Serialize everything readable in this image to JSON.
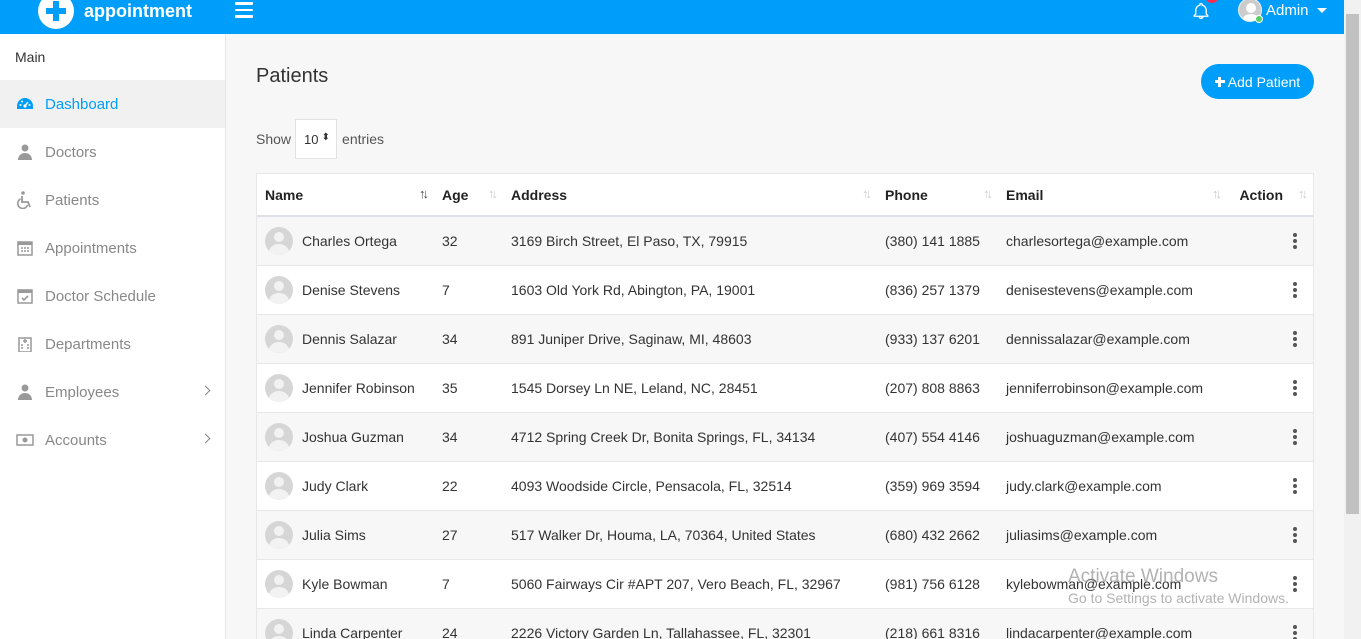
{
  "header": {
    "app_name": "appointment",
    "user_name": "Admin"
  },
  "sidebar": {
    "title": "Main",
    "items": [
      {
        "label": "Dashboard",
        "icon": "dashboard-icon",
        "active": true
      },
      {
        "label": "Doctors",
        "icon": "user-md-icon"
      },
      {
        "label": "Patients",
        "icon": "wheelchair-icon"
      },
      {
        "label": "Appointments",
        "icon": "calendar-icon"
      },
      {
        "label": "Doctor Schedule",
        "icon": "calendar-check-icon"
      },
      {
        "label": "Departments",
        "icon": "hospital-icon"
      },
      {
        "label": "Employees",
        "icon": "user-icon",
        "has_submenu": true
      },
      {
        "label": "Accounts",
        "icon": "money-icon",
        "has_submenu": true
      }
    ]
  },
  "page": {
    "title": "Patients",
    "add_button": "Add Patient",
    "show_label": "Show",
    "entries_value": "10",
    "entries_label": "entries"
  },
  "table": {
    "columns": [
      "Name",
      "Age",
      "Address",
      "Phone",
      "Email",
      "Action"
    ],
    "rows": [
      {
        "name": "Charles Ortega",
        "age": "32",
        "address": "3169 Birch Street, El Paso, TX, 79915",
        "phone": "(380) 141 1885",
        "email": "charlesortega@example.com"
      },
      {
        "name": "Denise Stevens",
        "age": "7",
        "address": "1603 Old York Rd, Abington, PA, 19001",
        "phone": "(836) 257 1379",
        "email": "denisestevens@example.com"
      },
      {
        "name": "Dennis Salazar",
        "age": "34",
        "address": "891 Juniper Drive, Saginaw, MI, 48603",
        "phone": "(933) 137 6201",
        "email": "dennissalazar@example.com"
      },
      {
        "name": "Jennifer Robinson",
        "age": "35",
        "address": "1545 Dorsey Ln NE, Leland, NC, 28451",
        "phone": "(207) 808 8863",
        "email": "jenniferrobinson@example.com"
      },
      {
        "name": "Joshua Guzman",
        "age": "34",
        "address": "4712 Spring Creek Dr, Bonita Springs, FL, 34134",
        "phone": "(407) 554 4146",
        "email": "joshuaguzman@example.com"
      },
      {
        "name": "Judy Clark",
        "age": "22",
        "address": "4093 Woodside Circle, Pensacola, FL, 32514",
        "phone": "(359) 969 3594",
        "email": "judy.clark@example.com"
      },
      {
        "name": "Julia Sims",
        "age": "27",
        "address": "517 Walker Dr, Houma, LA, 70364, United States",
        "phone": "(680) 432 2662",
        "email": "juliasims@example.com"
      },
      {
        "name": "Kyle Bowman",
        "age": "7",
        "address": "5060 Fairways Cir #APT 207, Vero Beach, FL, 32967",
        "phone": "(981) 756 6128",
        "email": "kylebowman@example.com"
      },
      {
        "name": "Linda Carpenter",
        "age": "24",
        "address": "2226 Victory Garden Ln, Tallahassee, FL, 32301",
        "phone": "(218) 661 8316",
        "email": "lindacarpenter@example.com"
      }
    ]
  },
  "watermark": {
    "line1": "Activate Windows",
    "line2": "Go to Settings to activate Windows."
  },
  "colors": {
    "primary": "#009efb",
    "notification_badge": "#f62d51",
    "online_dot": "#55ce63"
  }
}
